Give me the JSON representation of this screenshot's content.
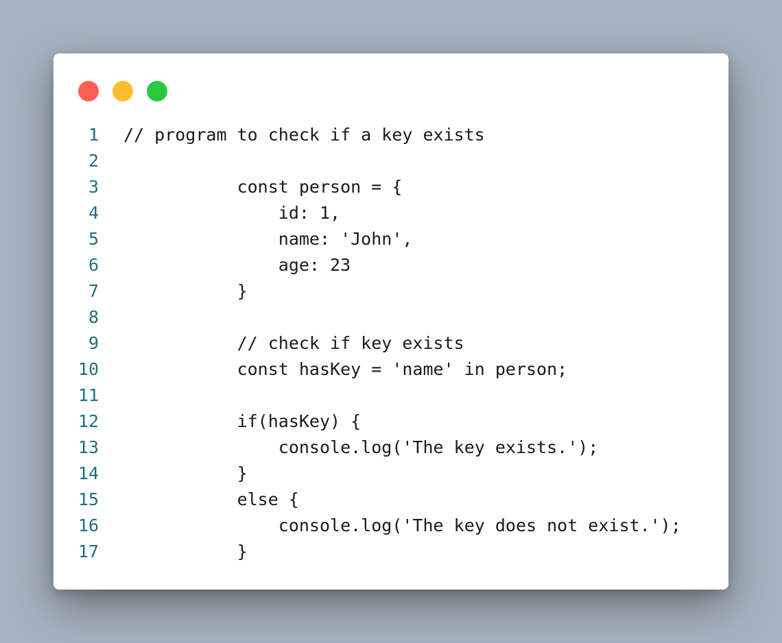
{
  "window": {
    "controls": [
      {
        "name": "close-dot",
        "color": "#ff5f56"
      },
      {
        "name": "minimize-dot",
        "color": "#ffbd2e"
      },
      {
        "name": "maximize-dot",
        "color": "#27c93f"
      }
    ]
  },
  "code": {
    "lines": [
      {
        "n": "1",
        "text": "// program to check if a key exists"
      },
      {
        "n": "2",
        "text": ""
      },
      {
        "n": "3",
        "text": "           const person = {"
      },
      {
        "n": "4",
        "text": "               id: 1,"
      },
      {
        "n": "5",
        "text": "               name: 'John',"
      },
      {
        "n": "6",
        "text": "               age: 23"
      },
      {
        "n": "7",
        "text": "           }"
      },
      {
        "n": "8",
        "text": ""
      },
      {
        "n": "9",
        "text": "           // check if key exists"
      },
      {
        "n": "10",
        "text": "           const hasKey = 'name' in person;"
      },
      {
        "n": "11",
        "text": ""
      },
      {
        "n": "12",
        "text": "           if(hasKey) {"
      },
      {
        "n": "13",
        "text": "               console.log('The key exists.');"
      },
      {
        "n": "14",
        "text": "           }"
      },
      {
        "n": "15",
        "text": "           else {"
      },
      {
        "n": "16",
        "text": "               console.log('The key does not exist.');"
      },
      {
        "n": "17",
        "text": "           }"
      }
    ]
  }
}
